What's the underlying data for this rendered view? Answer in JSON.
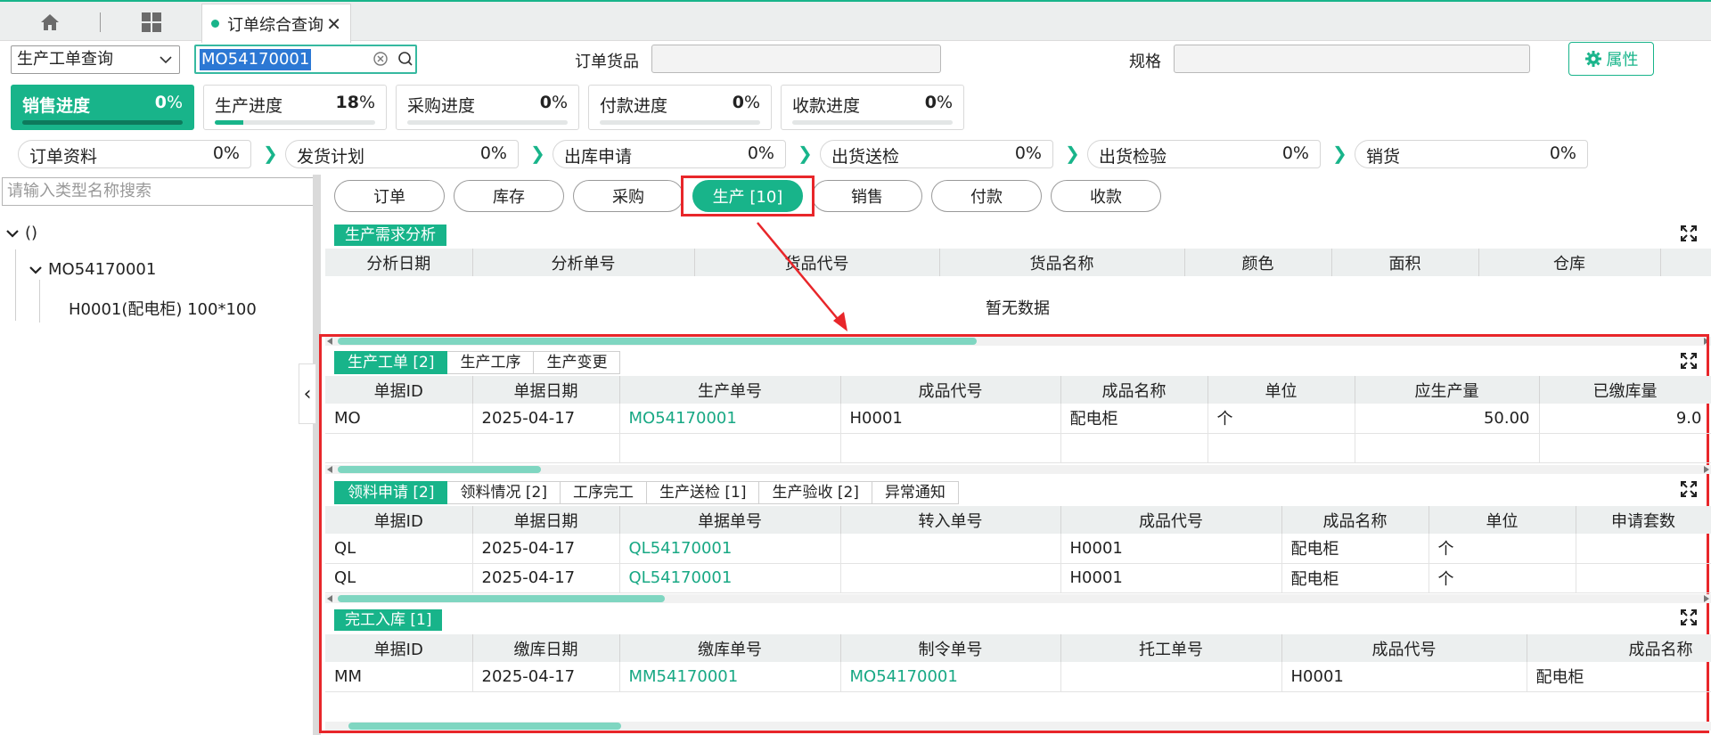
{
  "tabbar": {
    "home_icon": "home-icon",
    "grid_icon": "grid-icon",
    "active_tab": "订单综合查询",
    "close": "✕"
  },
  "toolbar": {
    "query_type": "生产工单查询",
    "search_value": "MO54170001",
    "goods_label": "订单货品",
    "spec_label": "规格",
    "prop_button": "属性"
  },
  "progress": [
    {
      "name": "销售进度",
      "pct": "0",
      "unit": "%",
      "fill": 0
    },
    {
      "name": "生产进度",
      "pct": "18",
      "unit": "%",
      "fill": 18
    },
    {
      "name": "采购进度",
      "pct": "0",
      "unit": "%",
      "fill": 0
    },
    {
      "name": "付款进度",
      "pct": "0",
      "unit": "%",
      "fill": 0
    },
    {
      "name": "收款进度",
      "pct": "0",
      "unit": "%",
      "fill": 0
    }
  ],
  "stages": [
    {
      "name": "订单资料",
      "pct": "0%"
    },
    {
      "name": "发货计划",
      "pct": "0%"
    },
    {
      "name": "出库申请",
      "pct": "0%"
    },
    {
      "name": "出货送检",
      "pct": "0%"
    },
    {
      "name": "出货检验",
      "pct": "0%"
    },
    {
      "name": "销货",
      "pct": "0%"
    }
  ],
  "tree": {
    "search_placeholder": "请输入类型名称搜索",
    "root": "()",
    "child": "MO54170001",
    "leaf": "H0001(配电柜) 100*100"
  },
  "main_tabs": [
    "订单",
    "库存",
    "采购",
    "生产 [10]",
    "销售",
    "付款",
    "收款"
  ],
  "demand": {
    "tag": "生产需求分析",
    "columns": [
      "分析日期",
      "分析单号",
      "货品代号",
      "货品名称",
      "颜色",
      "面积",
      "仓库"
    ],
    "empty": "暂无数据"
  },
  "work_orders": {
    "tabs": [
      "生产工单 [2]",
      "生产工序",
      "生产变更"
    ],
    "columns": [
      "单据ID",
      "单据日期",
      "生产单号",
      "成品代号",
      "成品名称",
      "单位",
      "应生产量",
      "已缴库量"
    ],
    "rows": [
      [
        "MO",
        "2025-04-17",
        "MO54170001",
        "H0001",
        "配电柜",
        "个",
        "50.00",
        "9.0"
      ]
    ]
  },
  "materials": {
    "tabs": [
      "领料申请 [2]",
      "领料情况 [2]",
      "工序完工",
      "生产送检 [1]",
      "生产验收 [2]",
      "异常通知"
    ],
    "columns": [
      "单据ID",
      "单据日期",
      "单据单号",
      "转入单号",
      "成品代号",
      "成品名称",
      "单位",
      "申请套数"
    ],
    "rows": [
      [
        "QL",
        "2025-04-17",
        "QL54170001",
        "",
        "H0001",
        "配电柜",
        "个",
        ""
      ],
      [
        "QL",
        "2025-04-17",
        "QL54170001",
        "",
        "H0001",
        "配电柜",
        "个",
        ""
      ]
    ]
  },
  "warehousing": {
    "tag": "完工入库 [1]",
    "columns": [
      "单据ID",
      "缴库日期",
      "缴库单号",
      "制令单号",
      "托工单号",
      "成品代号",
      "成品名称"
    ],
    "rows": [
      [
        "MM",
        "2025-04-17",
        "MM54170001",
        "MO54170001",
        "",
        "H0001",
        "配电柜"
      ]
    ]
  }
}
